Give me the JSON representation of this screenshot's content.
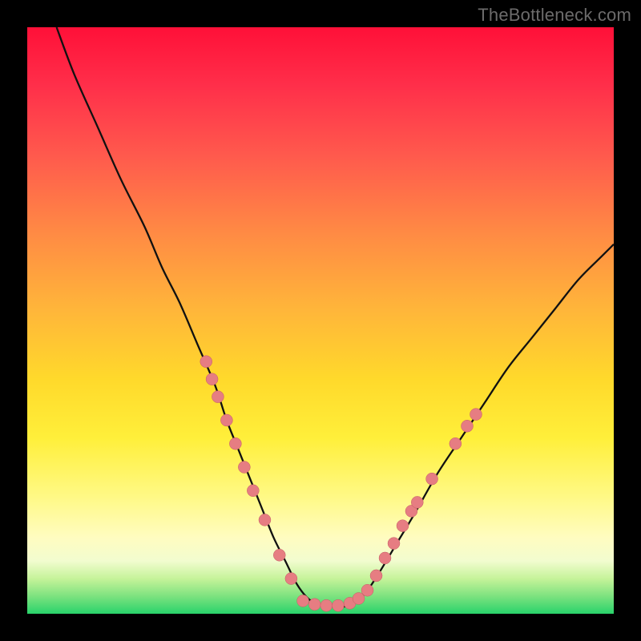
{
  "watermark": "TheBottleneck.com",
  "colors": {
    "curve_stroke": "#111111",
    "dot_fill": "#e67d82",
    "dot_stroke": "#c35d63"
  },
  "chart_data": {
    "type": "line",
    "title": "",
    "xlabel": "",
    "ylabel": "",
    "xlim": [
      0,
      100
    ],
    "ylim": [
      0,
      100
    ],
    "grid": false,
    "legend": false,
    "series": [
      {
        "name": "curve",
        "x": [
          5,
          8,
          12,
          16,
          20,
          23,
          26,
          29,
          32,
          34,
          36,
          38,
          40,
          42,
          44,
          46,
          48,
          50,
          52,
          54,
          56,
          58,
          60,
          63,
          66,
          70,
          74,
          78,
          82,
          86,
          90,
          94,
          98,
          100
        ],
        "y": [
          100,
          92,
          83,
          74,
          66,
          59,
          53,
          46,
          39,
          33,
          28,
          23,
          18,
          13,
          9,
          5,
          2.5,
          1.5,
          1.2,
          1.2,
          2,
          4,
          7,
          12,
          17,
          24,
          30,
          36,
          42,
          47,
          52,
          57,
          61,
          63
        ]
      }
    ],
    "dots_left": [
      {
        "x": 30.5,
        "y": 43
      },
      {
        "x": 31.5,
        "y": 40
      },
      {
        "x": 32.5,
        "y": 37
      },
      {
        "x": 34.0,
        "y": 33
      },
      {
        "x": 35.5,
        "y": 29
      },
      {
        "x": 37.0,
        "y": 25
      },
      {
        "x": 38.5,
        "y": 21
      },
      {
        "x": 40.5,
        "y": 16
      },
      {
        "x": 43.0,
        "y": 10
      },
      {
        "x": 45.0,
        "y": 6
      }
    ],
    "dots_right": [
      {
        "x": 58.0,
        "y": 4
      },
      {
        "x": 59.5,
        "y": 6.5
      },
      {
        "x": 61.0,
        "y": 9.5
      },
      {
        "x": 62.5,
        "y": 12
      },
      {
        "x": 64.0,
        "y": 15
      },
      {
        "x": 65.5,
        "y": 17.5
      },
      {
        "x": 66.5,
        "y": 19
      },
      {
        "x": 69.0,
        "y": 23
      },
      {
        "x": 73.0,
        "y": 29
      },
      {
        "x": 75.0,
        "y": 32
      },
      {
        "x": 76.5,
        "y": 34
      }
    ],
    "dots_bottom": [
      {
        "x": 47.0,
        "y": 2.2
      },
      {
        "x": 49.0,
        "y": 1.6
      },
      {
        "x": 51.0,
        "y": 1.4
      },
      {
        "x": 53.0,
        "y": 1.4
      },
      {
        "x": 55.0,
        "y": 1.8
      },
      {
        "x": 56.5,
        "y": 2.6
      }
    ]
  }
}
